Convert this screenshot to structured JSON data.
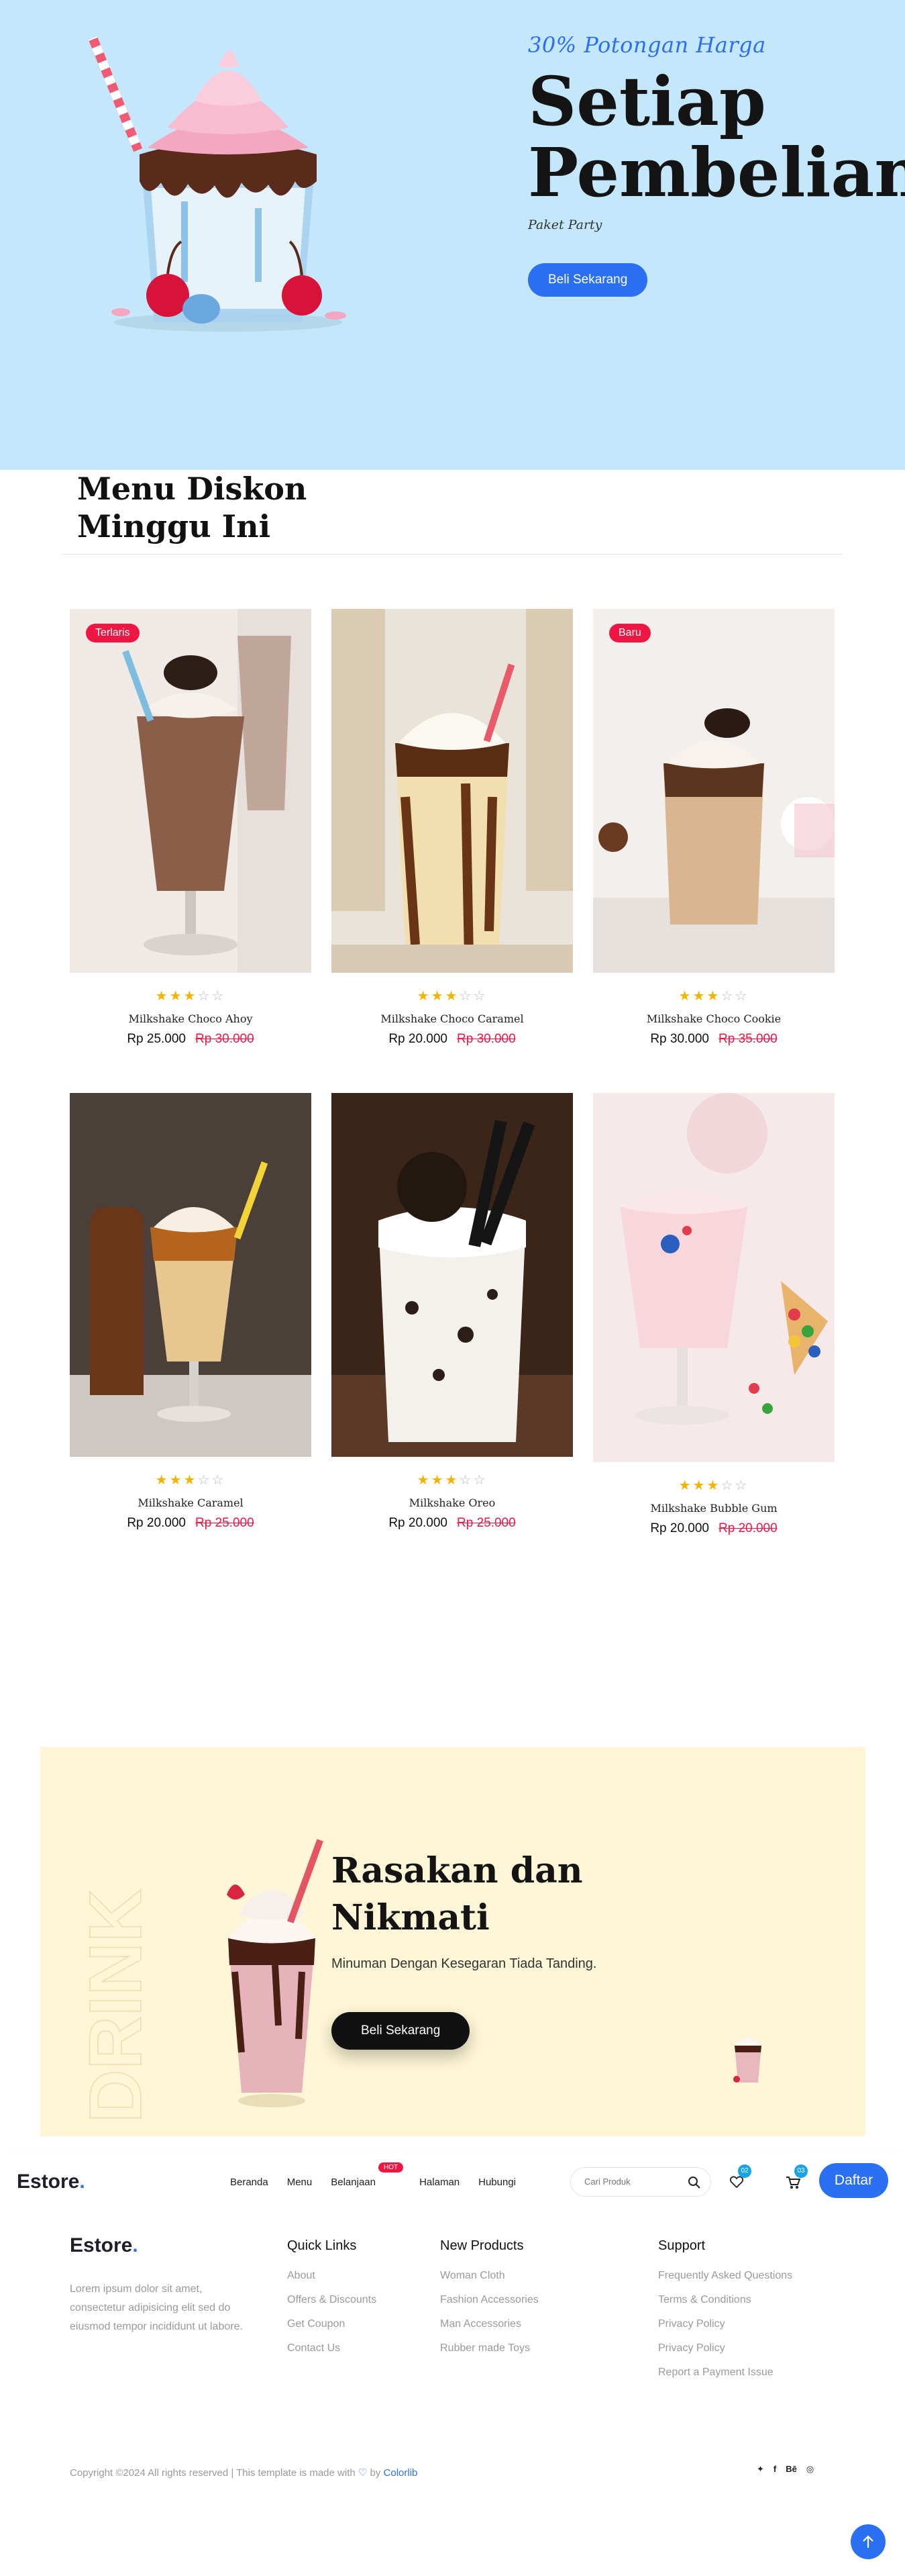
{
  "hero": {
    "tag": "30% Potongan Harga",
    "title_line1": "Setiap",
    "title_line2": "Pembelian",
    "subtitle": "Paket Party",
    "button": "Beli Sekarang",
    "background_color": "#c4e7fb"
  },
  "section": {
    "title_line1": "Menu Diskon",
    "title_line2": "Minggu Ini"
  },
  "products": [
    {
      "name": "Milkshake Choco Ahoy",
      "price": "Rp 25.000",
      "old_price": "Rp 30.000",
      "badge": "Terlaris",
      "rating": 3
    },
    {
      "name": "Milkshake Choco Caramel",
      "price": "Rp 20.000",
      "old_price": "Rp 30.000",
      "badge": "",
      "rating": 3
    },
    {
      "name": "Milkshake Choco Cookie",
      "price": "Rp 30.000",
      "old_price": "Rp 35.000",
      "badge": "Baru",
      "rating": 3
    },
    {
      "name": "Milkshake Caramel",
      "price": "Rp 20.000",
      "old_price": "Rp 25.000",
      "badge": "",
      "rating": 3
    },
    {
      "name": "Milkshake Oreo",
      "price": "Rp 20.000",
      "old_price": "Rp 25.000",
      "badge": "",
      "rating": 3
    },
    {
      "name": "Milkshake Bubble Gum",
      "price": "Rp 20.000",
      "old_price": "Rp 20.000",
      "badge": "",
      "rating": 3
    }
  ],
  "promo": {
    "watermark": "DRINK",
    "title_line1": "Rasakan dan",
    "title_line2": "Nikmati",
    "subtitle": "Minuman Dengan Kesegaran Tiada Tanding.",
    "button": "Beli Sekarang",
    "background_color": "#fef6d6"
  },
  "navbar": {
    "logo": "Estore",
    "logo_dot": ".",
    "links": [
      "Beranda",
      "Menu",
      "Belanjaan",
      "Halaman",
      "Hubungi"
    ],
    "hot_label": "HOT",
    "search_placeholder": "Cari Produk",
    "wishlist_count": "02",
    "cart_count": "03",
    "register_button": "Daftar",
    "icons": [
      "search-icon",
      "heart-icon",
      "cart-icon"
    ]
  },
  "footer": {
    "logo": "Estore",
    "logo_dot": ".",
    "description": "Lorem ipsum dolor sit amet, consectetur adipisicing elit sed do eiusmod tempor incididunt ut labore.",
    "columns": [
      {
        "title": "Quick Links",
        "links": [
          "About",
          "Offers & Discounts",
          "Get Coupon",
          "Contact Us"
        ]
      },
      {
        "title": "New Products",
        "links": [
          "Woman Cloth",
          "Fashion Accessories",
          "Man Accessories",
          "Rubber made Toys"
        ]
      },
      {
        "title": "Support",
        "links": [
          "Frequently Asked Questions",
          "Terms & Conditions",
          "Privacy Policy",
          "Privacy Policy",
          "Report a Payment Issue"
        ]
      }
    ],
    "copyright_text": "Copyright ©2024 All rights reserved | This template is made with",
    "copyright_by": "by",
    "copyright_brand": "Colorlib",
    "socials": [
      "twitter-icon",
      "facebook-icon",
      "behance-icon",
      "globe-icon"
    ],
    "social_glyphs": [
      "✦",
      "f",
      "Bē",
      "◎"
    ]
  },
  "colors": {
    "accent": "#2b6ff2",
    "sale": "#ef1643",
    "star": "#f5b301"
  }
}
